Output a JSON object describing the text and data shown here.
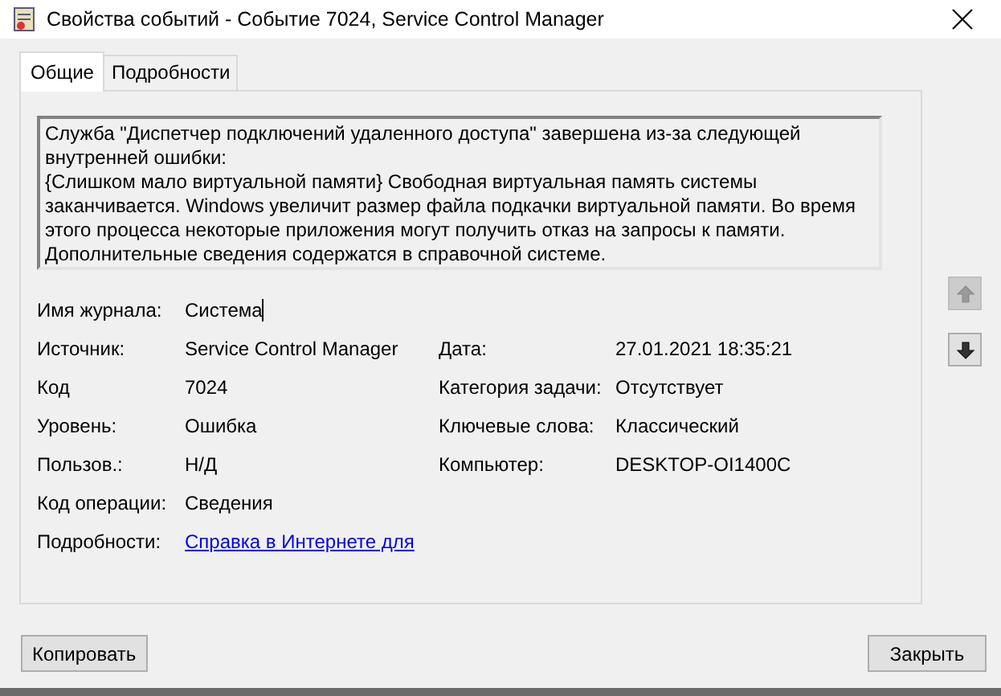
{
  "window": {
    "title": "Свойства событий - Событие 7024, Service Control Manager"
  },
  "tabs": [
    {
      "label": "Общие",
      "selected": true
    },
    {
      "label": "Подробности",
      "selected": false
    }
  ],
  "message": [
    "Служба \"Диспетчер подключений удаленного доступа\" завершена из-за следующей внутренней ошибки:",
    "{Слишком мало виртуальной памяти} Свободная виртуальная память системы заканчивается. Windows увеличит размер файла подкачки виртуальной памяти. Во время этого процесса некоторые приложения могут получить отказ на запросы к памяти. Дополнительные сведения содержатся в справочной системе."
  ],
  "rows": [
    {
      "left": {
        "label": "Имя журнала:",
        "value": "Система",
        "kind": "field"
      }
    },
    {
      "left": {
        "label": "Источник:",
        "value": "Service Control Manager",
        "kind": "text"
      },
      "right": {
        "label": "Дата:",
        "value": "27.01.2021 18:35:21",
        "kind": "text"
      }
    },
    {
      "left": {
        "label": "Код",
        "value": "7024",
        "kind": "text"
      },
      "right": {
        "label": "Категория задачи:",
        "value": "Отсутствует",
        "kind": "text"
      }
    },
    {
      "left": {
        "label": "Уровень:",
        "value": "Ошибка",
        "kind": "text"
      },
      "right": {
        "label": "Ключевые слова:",
        "value": "Классический",
        "kind": "text"
      }
    },
    {
      "left": {
        "label": "Пользов.:",
        "value": "Н/Д",
        "kind": "text"
      },
      "right": {
        "label": "Компьютер:",
        "value": "DESKTOP-OI1400C",
        "kind": "text"
      }
    },
    {
      "left": {
        "label": "Код операции:",
        "value": "Сведения",
        "kind": "text"
      }
    },
    {
      "left": {
        "label": "Подробности:",
        "value": "Справка в Интернете для",
        "kind": "link"
      }
    }
  ],
  "nav": [
    {
      "kind": "up",
      "disabled": true
    },
    {
      "kind": "down",
      "disabled": false
    }
  ],
  "buttons": [
    {
      "label": "Копировать"
    },
    {
      "label": "Закрыть"
    }
  ]
}
